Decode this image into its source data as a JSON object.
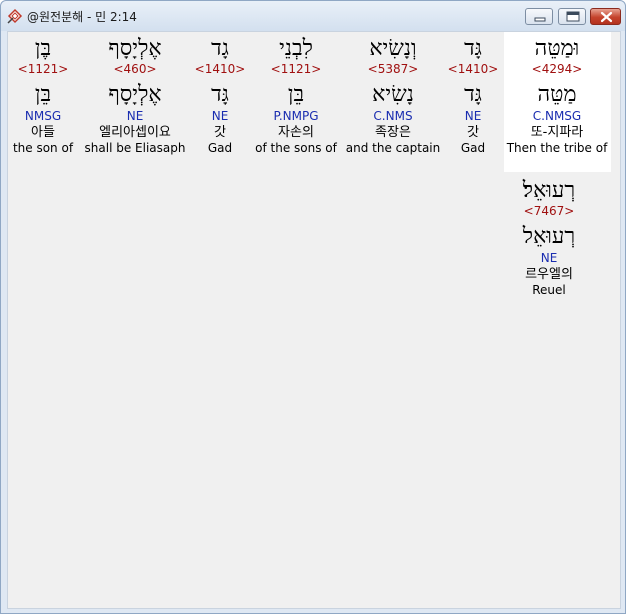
{
  "window": {
    "title": "@원전분해 - 민 2:14"
  },
  "words": [
    {
      "heb1": "וּמַטֵּה",
      "strong": "<4294>",
      "heb2": "מַטֵּה",
      "morph": "C.NMSG",
      "kor": "또-지파라",
      "eng": "Then the tribe of"
    },
    {
      "heb1": "גָּד",
      "strong": "<1410>",
      "heb2": "גָּד",
      "morph": "NE",
      "kor": "갓",
      "eng": "Gad"
    },
    {
      "heb1": "וְנָשִׂיא",
      "strong": "<5387>",
      "heb2": "נָשִׂיא",
      "morph": "C.NMS",
      "kor": "족장은",
      "eng": "and the captain"
    },
    {
      "heb1": "לִבְנֵי",
      "strong": "<1121>",
      "heb2": "בֵּן",
      "morph": "P.NMPG",
      "kor": "자손의",
      "eng": "of the sons of"
    },
    {
      "heb1": "גָד",
      "strong": "<1410>",
      "heb2": "גָּד",
      "morph": "NE",
      "kor": "갓",
      "eng": "Gad"
    },
    {
      "heb1": "אֶלְיָסָף",
      "strong": "<460>",
      "heb2": "אֶלְיָסָף",
      "morph": "NE",
      "kor": "엘리아셉이요",
      "eng": "shall be Eliasaph"
    },
    {
      "heb1": "בֶּן",
      "strong": "<1121>",
      "heb2": "בֵּן",
      "morph": "NMSG",
      "kor": "아들",
      "eng": "the son of"
    },
    {
      "heb1": "רְעוּאֵל׃",
      "strong": "<7467>",
      "heb2": "רְעוּאֵל",
      "morph": "NE",
      "kor": "르우엘의",
      "eng": "Reuel"
    }
  ]
}
